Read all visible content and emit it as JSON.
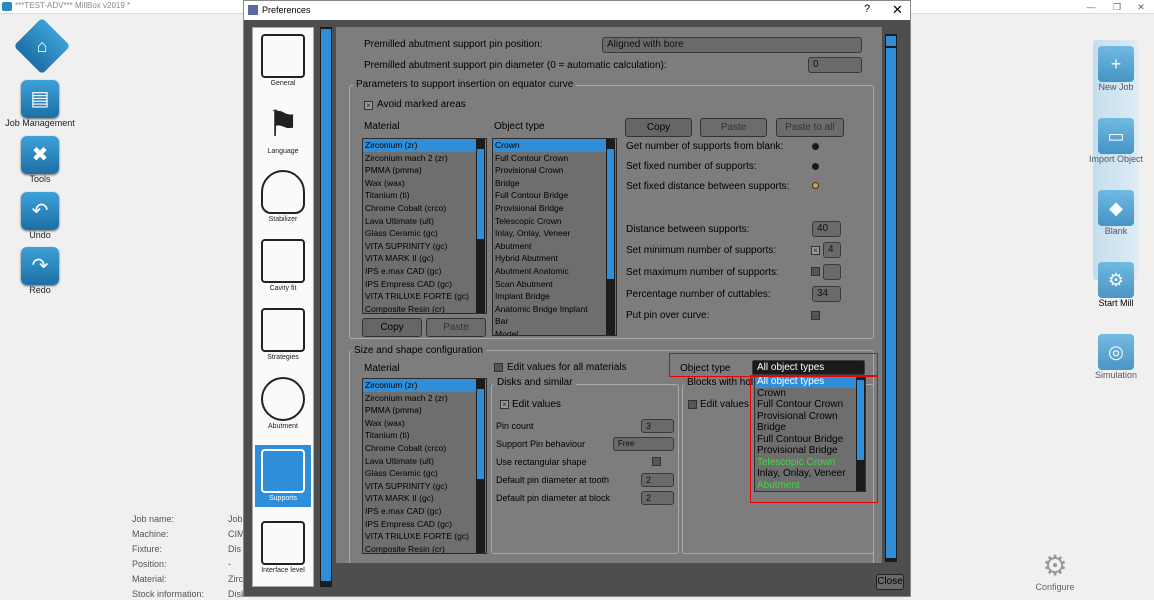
{
  "app": {
    "title": "***TEST-ADV*** MillBox v2019 *"
  },
  "left_tools": [
    {
      "label": "Job Management",
      "icon": "job-management-icon"
    },
    {
      "label": "Tools",
      "icon": "tools-icon"
    },
    {
      "label": "Undo",
      "icon": "undo-icon"
    },
    {
      "label": "Redo",
      "icon": "redo-icon"
    }
  ],
  "right_tools": [
    {
      "label": "New Job"
    },
    {
      "label": "Import Object"
    },
    {
      "label": "Blank"
    },
    {
      "label": "Start Mill"
    },
    {
      "label": "Simulation"
    }
  ],
  "job_info": {
    "labels": [
      "Job name:",
      "Machine:",
      "Fixture:",
      "Position:",
      "Material:",
      "Stock information:"
    ],
    "values": [
      "Job",
      "CIM",
      "Dis",
      "-",
      "Zirc",
      "Disk"
    ]
  },
  "configure_label": "Configure",
  "dialog": {
    "title": "Preferences",
    "help": "?",
    "close_x": "✕",
    "close_button": "Close",
    "nav": [
      "General",
      "Language",
      "Stabilizer",
      "Cavity fit",
      "Strategies",
      "Abutment",
      "Supports",
      "Interface level"
    ],
    "pin_position_label": "Premilled abutment support pin position:",
    "pin_position_value": "Aligned with bore",
    "pin_diameter_label": "Premilled abutment support pin diameter (0 = automatic calculation):",
    "pin_diameter_value": "0",
    "equator": {
      "title": "Parameters to support insertion on equator curve",
      "avoid_label": "Avoid marked areas",
      "material_header": "Material",
      "object_header": "Object type",
      "copy": "Copy",
      "paste": "Paste",
      "paste_all": "Paste to all",
      "copy2": "Copy",
      "paste2": "Paste",
      "opt1": "Get number of supports from blank:",
      "opt2": "Set fixed number of supports:",
      "opt3": "Set fixed distance between supports:",
      "distance_label": "Distance between supports:",
      "distance_value": "40",
      "min_label": "Set minimum number of supports:",
      "min_value": "4",
      "max_label": "Set maximum number of supports:",
      "max_value": "",
      "pct_label": "Percentage number of cuttables:",
      "pct_value": "34",
      "pin_curve_label": "Put pin over curve:"
    },
    "materials": [
      "Zirconium (zr)",
      "Zirconium mach 2 (zr)",
      "PMMA (pmma)",
      "Wax (wax)",
      "Titanium (ti)",
      "Chrome Cobalt (crco)",
      "Lava Ultimate (ult)",
      "Glass Ceramic (gc)",
      "VITA SUPRINITY (gc)",
      "VITA MARK II (gc)",
      "IPS e.max CAD (gc)",
      "IPS Empress CAD (gc)",
      "VITA TRILUXE FORTE (gc)",
      "Composite Resin (cr)"
    ],
    "object_types": [
      "Crown",
      "Full Contour Crown",
      "Provisional Crown",
      "Bridge",
      "Full Contour Bridge",
      "Provisional Bridge",
      "Telescopic Crown",
      "Inlay, Onlay, Veneer",
      "Abutment",
      "Hybrid Abutment",
      "Abutment Anatomic",
      "Scan Abutment",
      "Implant Bridge",
      "Anatomic Bridge Implant",
      "Bar",
      "Model"
    ],
    "size_shape": {
      "title": "Size and shape configuration",
      "edit_all_label": "Edit values for all materials",
      "material_header": "Material",
      "object_type_label": "Object type",
      "object_type_value": "All object types",
      "disks_title": "Disks and similar",
      "blocks_title": "Blocks with hol",
      "edit_values": "Edit values",
      "edit_values2": "Edit values",
      "pin_count_label": "Pin count",
      "pin_count_value": "3",
      "behaviour_label": "Support Pin behaviour",
      "behaviour_value": "Free",
      "rect_label": "Use rectangular shape",
      "tooth_label": "Default pin diameter at tooth",
      "tooth_value": "2",
      "block_label": "Default pin diameter at block",
      "block_value": "2"
    },
    "dropdown_items": [
      {
        "label": "All object types",
        "state": "selected"
      },
      {
        "label": "Crown",
        "state": "normal"
      },
      {
        "label": "Full Contour Crown",
        "state": "normal"
      },
      {
        "label": "Provisional Crown",
        "state": "normal"
      },
      {
        "label": "Bridge",
        "state": "normal"
      },
      {
        "label": "Full Contour Bridge",
        "state": "normal"
      },
      {
        "label": "Provisional Bridge",
        "state": "normal"
      },
      {
        "label": "Telescopic Crown",
        "state": "green"
      },
      {
        "label": "Inlay, Onlay, Veneer",
        "state": "normal"
      },
      {
        "label": "Abutment",
        "state": "green"
      }
    ]
  },
  "colors": {
    "accent": "#2f8ed7",
    "panel": "#7d7d7d",
    "highlight_box": "#e00000",
    "green_text": "#3ddc3d",
    "radio_active": "#e0a020"
  }
}
